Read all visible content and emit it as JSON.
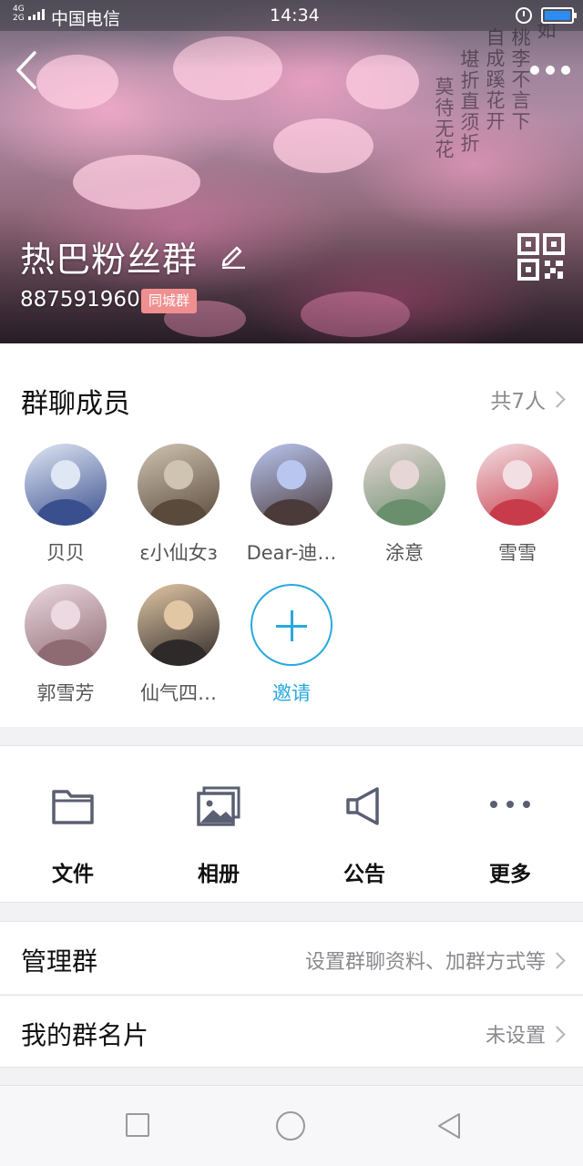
{
  "status_bar": {
    "network": "4G\n2G",
    "carrier": "中国电信",
    "time": "14:34"
  },
  "header": {
    "group_name": "热巴粉丝群",
    "group_id": "887591960",
    "badge": "同城群",
    "background_poem": [
      "如",
      "桃",
      "李",
      "不",
      "言",
      "下",
      "自",
      "成",
      "蹊",
      "花",
      "开",
      "堪",
      "折",
      "直",
      "须",
      "折",
      "莫",
      "待",
      "无",
      "花"
    ]
  },
  "members": {
    "title": "群聊成员",
    "count": "共7人",
    "list": [
      {
        "name": "贝贝",
        "avatar_colors": [
          "#dfe6f4",
          "#3a4f8e"
        ]
      },
      {
        "name": "ε小仙女з",
        "avatar_colors": [
          "#cfc3b1",
          "#5a4a3c"
        ]
      },
      {
        "name": "Dear-迪…",
        "avatar_colors": [
          "#b9c6ef",
          "#4b3a3a"
        ]
      },
      {
        "name": "涂意",
        "avatar_colors": [
          "#e6d7d6",
          "#6a8f6c"
        ]
      },
      {
        "name": "雪雪",
        "avatar_colors": [
          "#f2dfe3",
          "#c83b4a"
        ]
      },
      {
        "name": "郭雪芳",
        "avatar_colors": [
          "#ecd9e1",
          "#8e6a72"
        ]
      },
      {
        "name": "仙气四…",
        "avatar_colors": [
          "#e2c7a5",
          "#2f2a2a"
        ]
      }
    ],
    "invite_label": "邀请"
  },
  "tools": [
    {
      "label": "文件",
      "icon": "folder-icon"
    },
    {
      "label": "相册",
      "icon": "album-icon"
    },
    {
      "label": "公告",
      "icon": "announcement-icon"
    },
    {
      "label": "更多",
      "icon": "more-dots-icon"
    }
  ],
  "settings": {
    "manage_label": "管理群",
    "manage_value": "设置群聊资料、加群方式等",
    "card_label": "我的群名片",
    "card_value": "未设置"
  },
  "colors": {
    "accent": "#29a8de",
    "badge": "#f08f8f",
    "icon": "#5a5f72",
    "battery": "#2d8cf0"
  }
}
